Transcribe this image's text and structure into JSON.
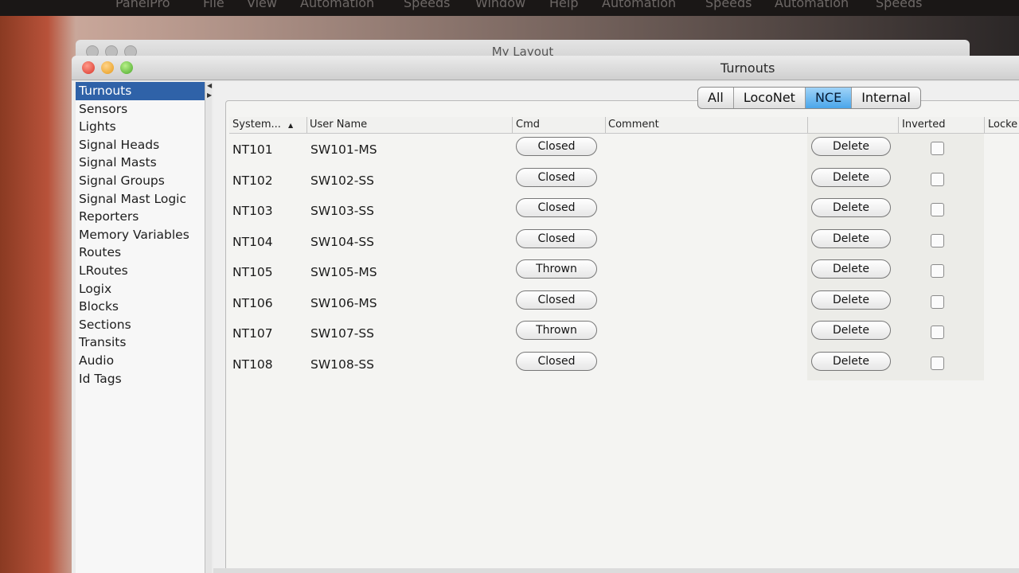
{
  "menubar": {
    "items": [
      "PanelPro",
      "File",
      "View",
      "Automation",
      "Speeds",
      "Window",
      "Help",
      "Automation",
      "Speeds",
      "Automation",
      "Speeds"
    ]
  },
  "back_window": {
    "title": "My Layout"
  },
  "window": {
    "title": "Turnouts"
  },
  "sidebar": {
    "items": [
      {
        "label": "Turnouts",
        "selected": true
      },
      {
        "label": "Sensors"
      },
      {
        "label": "Lights"
      },
      {
        "label": "Signal Heads"
      },
      {
        "label": "Signal Masts"
      },
      {
        "label": "Signal Groups"
      },
      {
        "label": "Signal Mast Logic"
      },
      {
        "label": "Reporters"
      },
      {
        "label": "Memory Variables"
      },
      {
        "label": "Routes"
      },
      {
        "label": "LRoutes"
      },
      {
        "label": "Logix"
      },
      {
        "label": "Blocks"
      },
      {
        "label": "Sections"
      },
      {
        "label": "Transits"
      },
      {
        "label": "Audio"
      },
      {
        "label": "Id Tags"
      }
    ]
  },
  "filter_tabs": {
    "items": [
      "All",
      "LocoNet",
      "NCE",
      "Internal"
    ],
    "active": "NCE"
  },
  "table": {
    "columns": {
      "system": "System...",
      "user_name": "User Name",
      "cmd": "Cmd",
      "comment": "Comment",
      "delete": "",
      "inverted": "Inverted",
      "locked": "Locke"
    },
    "rows": [
      {
        "system": "NT101",
        "user_name": "SW101-MS",
        "cmd": "Closed",
        "comment": "",
        "delete": "Delete",
        "inverted": false
      },
      {
        "system": "NT102",
        "user_name": "SW102-SS",
        "cmd": "Closed",
        "comment": "",
        "delete": "Delete",
        "inverted": false
      },
      {
        "system": "NT103",
        "user_name": "SW103-SS",
        "cmd": "Closed",
        "comment": "",
        "delete": "Delete",
        "inverted": false
      },
      {
        "system": "NT104",
        "user_name": "SW104-SS",
        "cmd": "Closed",
        "comment": "",
        "delete": "Delete",
        "inverted": false
      },
      {
        "system": "NT105",
        "user_name": "SW105-MS",
        "cmd": "Thrown",
        "comment": "",
        "delete": "Delete",
        "inverted": false
      },
      {
        "system": "NT106",
        "user_name": "SW106-MS",
        "cmd": "Closed",
        "comment": "",
        "delete": "Delete",
        "inverted": false
      },
      {
        "system": "NT107",
        "user_name": "SW107-SS",
        "cmd": "Thrown",
        "comment": "",
        "delete": "Delete",
        "inverted": false
      },
      {
        "system": "NT108",
        "user_name": "SW108-SS",
        "cmd": "Closed",
        "comment": "",
        "delete": "Delete",
        "inverted": false
      }
    ]
  },
  "colors": {
    "selection": "#2f62a8",
    "active_tab": "#4aa6ea"
  }
}
